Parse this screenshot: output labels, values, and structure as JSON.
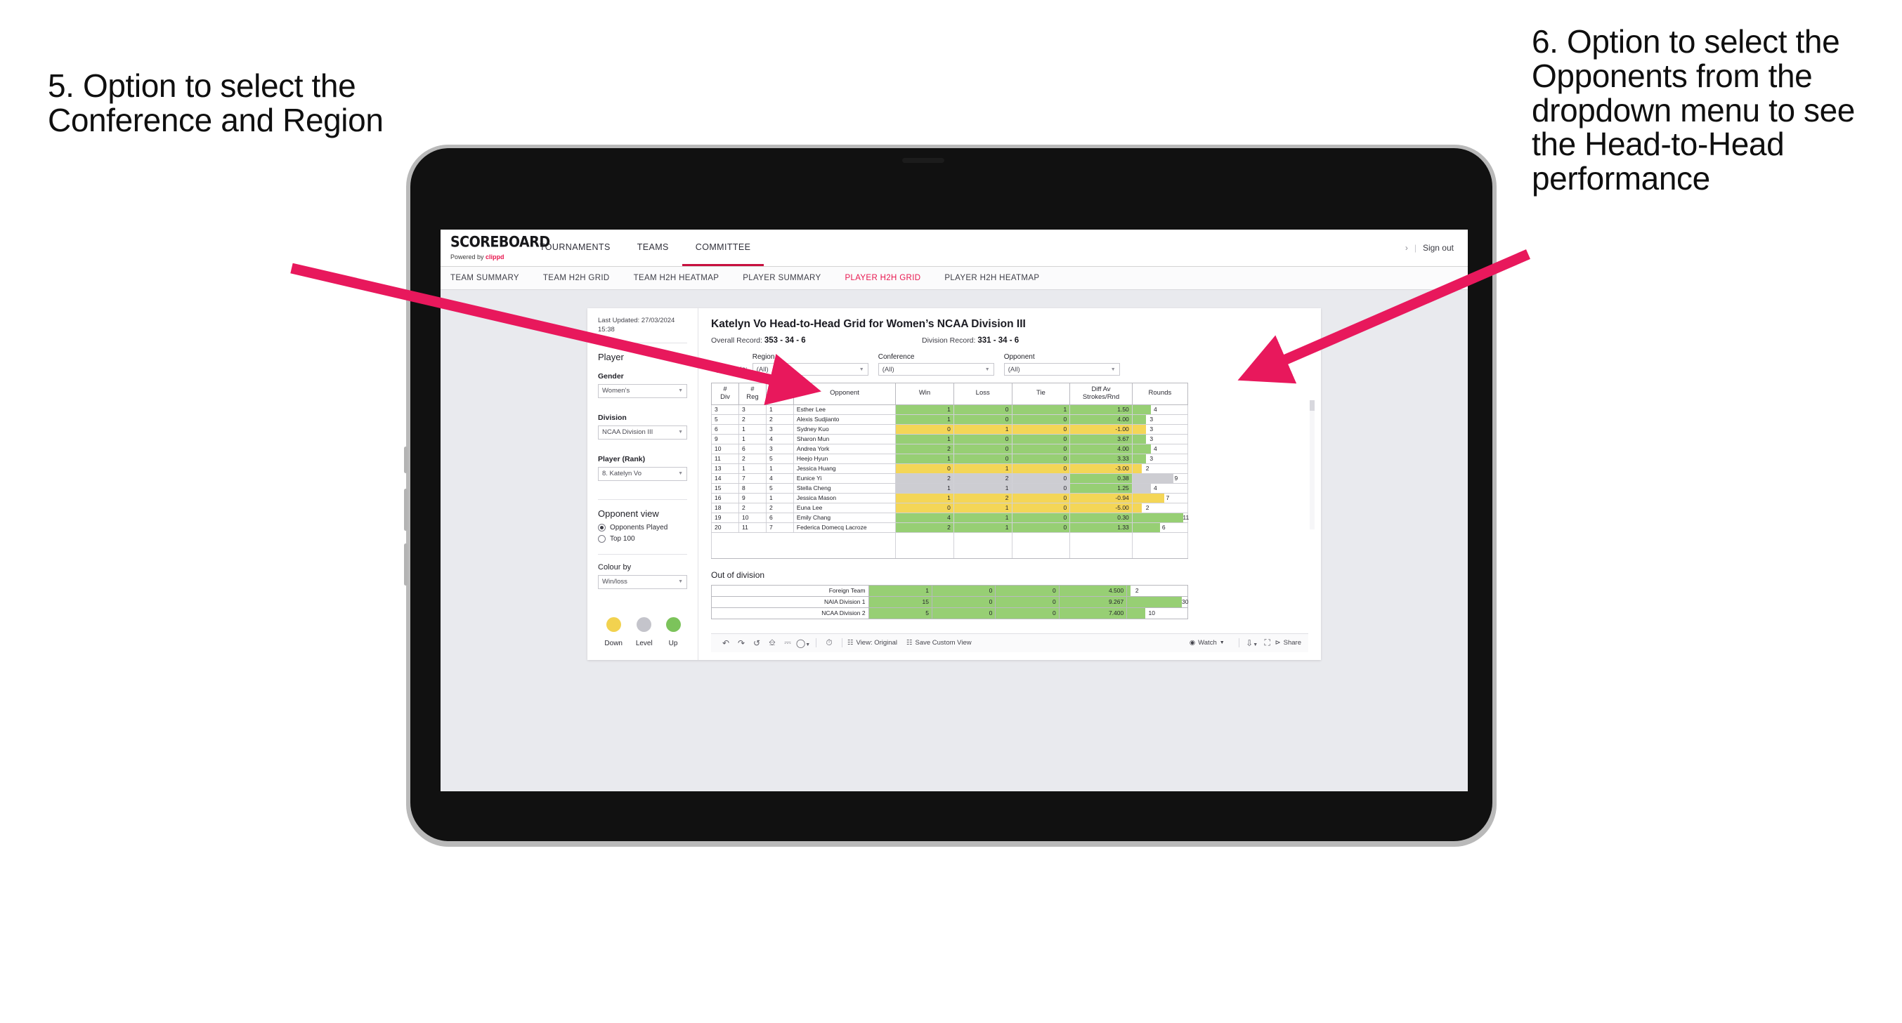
{
  "annotations": {
    "left": "5. Option to select the Conference and Region",
    "right": "6. Option to select the Opponents from the dropdown menu to see the Head-to-Head performance",
    "arrow_color": "#e8185c"
  },
  "app": {
    "brand": {
      "title": "SCOREBOARD",
      "powered_prefix": "Powered by ",
      "powered_brand": "clippd"
    },
    "topnav": [
      {
        "label": "TOURNAMENTS",
        "active": false
      },
      {
        "label": "TEAMS",
        "active": false
      },
      {
        "label": "COMMITTEE",
        "active": true
      }
    ],
    "account": {
      "chevron": "›",
      "divider": "|",
      "signout": "Sign out"
    },
    "subnav": [
      {
        "label": "TEAM SUMMARY",
        "active": false
      },
      {
        "label": "TEAM H2H GRID",
        "active": false
      },
      {
        "label": "TEAM H2H HEATMAP",
        "active": false
      },
      {
        "label": "PLAYER SUMMARY",
        "active": false
      },
      {
        "label": "PLAYER H2H GRID",
        "active": true
      },
      {
        "label": "PLAYER H2H HEATMAP",
        "active": false
      }
    ]
  },
  "sidebar": {
    "last_updated": "Last Updated: 27/03/2024 15:38",
    "player_heading": "Player",
    "gender": {
      "label": "Gender",
      "value": "Women’s"
    },
    "division": {
      "label": "Division",
      "value": "NCAA Division III"
    },
    "player_rank": {
      "label": "Player (Rank)",
      "value": "8. Katelyn Vo"
    },
    "opponent_view": {
      "heading": "Opponent view",
      "options": [
        {
          "label": "Opponents Played",
          "selected": true
        },
        {
          "label": "Top 100",
          "selected": false
        }
      ]
    },
    "colour_by": {
      "label": "Colour by",
      "value": "Win/loss"
    },
    "legend": [
      {
        "label": "Down",
        "color": "#f2d24f"
      },
      {
        "label": "Level",
        "color": "#c4c4cb"
      },
      {
        "label": "Up",
        "color": "#7cc35b"
      }
    ]
  },
  "main": {
    "title": "Katelyn Vo Head-to-Head Grid for Women’s NCAA Division III",
    "overall_record_label": "Overall Record:",
    "overall_record_value": "353 - 34 - 6",
    "division_record_label": "Division Record:",
    "division_record_value": "331 - 34 - 6",
    "filters_lead": "Opponents:",
    "filters": [
      {
        "label": "Region",
        "value": "(All)"
      },
      {
        "label": "Conference",
        "value": "(All)"
      },
      {
        "label": "Opponent",
        "value": "(All)"
      }
    ],
    "grid_headers": [
      "# Div",
      "# Reg",
      "# Conf",
      "Opponent",
      "Win",
      "Loss",
      "Tie",
      "Diff Av Strokes/Rnd",
      "Rounds"
    ],
    "out_of_division_heading": "Out of division"
  },
  "chart_data": {
    "type": "table",
    "title": "Katelyn Vo Head-to-Head Grid for Women’s NCAA Division III",
    "columns": [
      "# Div",
      "# Reg",
      "# Conf",
      "Opponent",
      "Win",
      "Loss",
      "Tie",
      "Diff Av Strokes/Rnd",
      "Rounds"
    ],
    "colour_legend": {
      "down": "#f2d24f",
      "level": "#c4c4cb",
      "up": "#7cc35b"
    },
    "rounds_axis_max": 12,
    "rows": [
      {
        "div": "3",
        "reg": "3",
        "conf": "1",
        "opponent": "Esther Lee",
        "win": "1",
        "loss": "0",
        "tie": "1",
        "diff": "1.50",
        "rounds": 4,
        "state": "up"
      },
      {
        "div": "5",
        "reg": "2",
        "conf": "2",
        "opponent": "Alexis Sudjianto",
        "win": "1",
        "loss": "0",
        "tie": "0",
        "diff": "4.00",
        "rounds": 3,
        "state": "up"
      },
      {
        "div": "6",
        "reg": "1",
        "conf": "3",
        "opponent": "Sydney Kuo",
        "win": "0",
        "loss": "1",
        "tie": "0",
        "diff": "-1.00",
        "rounds": 3,
        "state": "down"
      },
      {
        "div": "9",
        "reg": "1",
        "conf": "4",
        "opponent": "Sharon Mun",
        "win": "1",
        "loss": "0",
        "tie": "0",
        "diff": "3.67",
        "rounds": 3,
        "state": "up"
      },
      {
        "div": "10",
        "reg": "6",
        "conf": "3",
        "opponent": "Andrea York",
        "win": "2",
        "loss": "0",
        "tie": "0",
        "diff": "4.00",
        "rounds": 4,
        "state": "up"
      },
      {
        "div": "11",
        "reg": "2",
        "conf": "5",
        "opponent": "Heejo Hyun",
        "win": "1",
        "loss": "0",
        "tie": "0",
        "diff": "3.33",
        "rounds": 3,
        "state": "up"
      },
      {
        "div": "13",
        "reg": "1",
        "conf": "1",
        "opponent": "Jessica Huang",
        "win": "0",
        "loss": "1",
        "tie": "0",
        "diff": "-3.00",
        "rounds": 2,
        "state": "down"
      },
      {
        "div": "14",
        "reg": "7",
        "conf": "4",
        "opponent": "Eunice Yi",
        "win": "2",
        "loss": "2",
        "tie": "0",
        "diff": "0.38",
        "rounds": 9,
        "state": "level",
        "diff_state": "up"
      },
      {
        "div": "15",
        "reg": "8",
        "conf": "5",
        "opponent": "Stella Cheng",
        "win": "1",
        "loss": "1",
        "tie": "0",
        "diff": "1.25",
        "rounds": 4,
        "state": "level",
        "diff_state": "up"
      },
      {
        "div": "16",
        "reg": "9",
        "conf": "1",
        "opponent": "Jessica Mason",
        "win": "1",
        "loss": "2",
        "tie": "0",
        "diff": "-0.94",
        "rounds": 7,
        "state": "down"
      },
      {
        "div": "18",
        "reg": "2",
        "conf": "2",
        "opponent": "Euna Lee",
        "win": "0",
        "loss": "1",
        "tie": "0",
        "diff": "-5.00",
        "rounds": 2,
        "state": "down"
      },
      {
        "div": "19",
        "reg": "10",
        "conf": "6",
        "opponent": "Emily Chang",
        "win": "4",
        "loss": "1",
        "tie": "0",
        "diff": "0.30",
        "rounds": 11,
        "state": "up"
      },
      {
        "div": "20",
        "reg": "11",
        "conf": "7",
        "opponent": "Federica Domecq Lacroze",
        "win": "2",
        "loss": "1",
        "tie": "0",
        "diff": "1.33",
        "rounds": 6,
        "state": "up"
      }
    ],
    "out_of_division": [
      {
        "name": "Foreign Team",
        "win": "1",
        "loss": "0",
        "tie": "0",
        "diff": "4.500",
        "rounds": 2,
        "state": "up"
      },
      {
        "name": "NAIA Division 1",
        "win": "15",
        "loss": "0",
        "tie": "0",
        "diff": "9.267",
        "rounds": 30,
        "state": "up"
      },
      {
        "name": "NCAA Division 2",
        "win": "5",
        "loss": "0",
        "tie": "0",
        "diff": "7.400",
        "rounds": 10,
        "state": "up"
      }
    ],
    "out_of_division_rounds_max": 33
  },
  "toolbar": {
    "view_label": "View: Original",
    "save_label": "Save Custom View",
    "watch_label": "Watch",
    "share_label": "Share"
  }
}
